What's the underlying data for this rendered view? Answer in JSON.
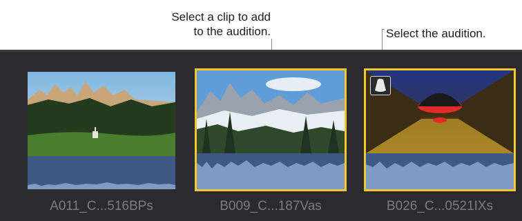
{
  "callouts": {
    "clip_callout_line1": "Select a clip to add",
    "clip_callout_line2": "to the audition.",
    "audition_callout": "Select the audition."
  },
  "clips": [
    {
      "name": "A011_C...516BPs",
      "selected": false,
      "audition": false
    },
    {
      "name": "B009_C...187Vas",
      "selected": true,
      "audition": false
    },
    {
      "name": "B026_C...0521IXs",
      "selected": true,
      "audition": true
    }
  ],
  "colors": {
    "browser_background": "#2b2b2d",
    "selection_border": "#f3c731",
    "waveform_background": "#3d5a86",
    "waveform_fill": "#7f9ac4",
    "label_text": "#7d7d80"
  },
  "icons": {
    "audition_badge": "audition-spotlight-icon"
  }
}
